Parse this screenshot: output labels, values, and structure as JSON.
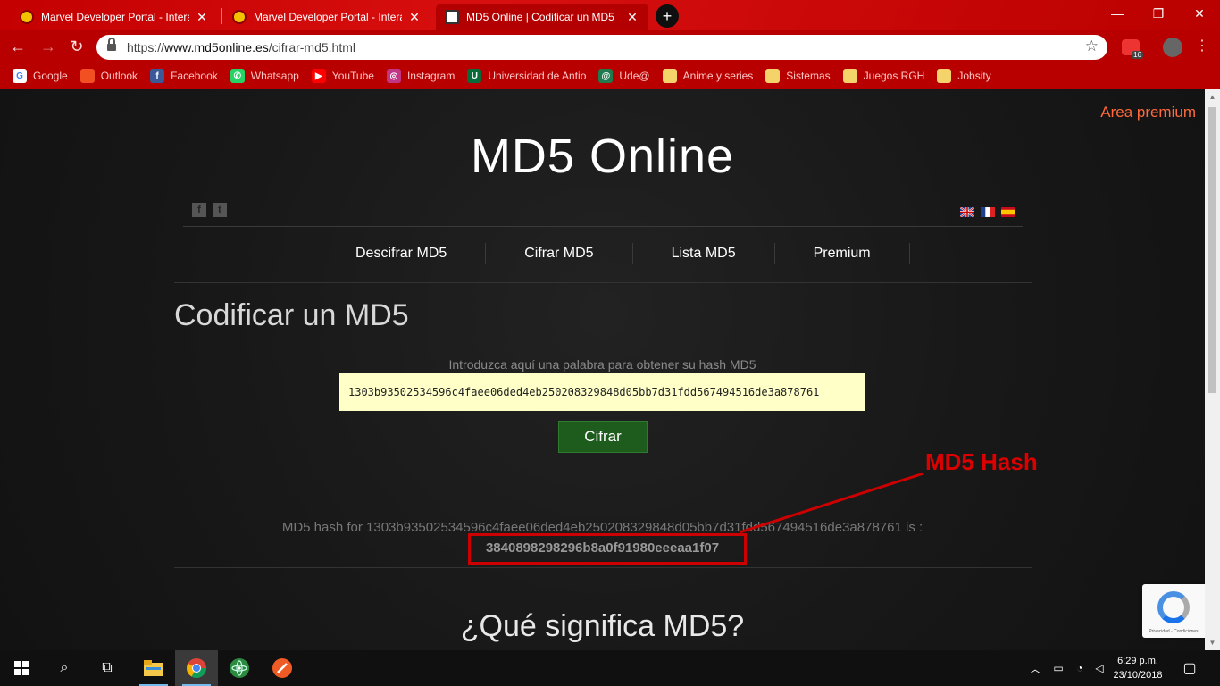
{
  "browser": {
    "tabs": [
      {
        "title": "Marvel Developer Portal - Interac",
        "close": "✕"
      },
      {
        "title": "Marvel Developer Portal - Interac",
        "close": "✕"
      },
      {
        "title": "MD5 Online | Codificar un MD5",
        "close": "✕"
      }
    ],
    "new_tab": "+",
    "window_controls": {
      "minimize": "—",
      "maximize": "❐",
      "close": "✕"
    },
    "url_prefix": "https://",
    "url_host": "www.md5online.es",
    "url_path": "/cifrar-md5.html",
    "extension_badge": "16",
    "bookmarks": [
      {
        "label": "Google",
        "icon": "G",
        "color": "#ffffff"
      },
      {
        "label": "Outlook",
        "icon": "",
        "color": "#f25022"
      },
      {
        "label": "Facebook",
        "icon": "f",
        "color": "#3b5998"
      },
      {
        "label": "Whatsapp",
        "icon": "✆",
        "color": "#25d366"
      },
      {
        "label": "YouTube",
        "icon": "▶",
        "color": "#ff0000"
      },
      {
        "label": "Instagram",
        "icon": "◎",
        "color": "#c13584"
      },
      {
        "label": "Universidad de Antio",
        "icon": "U",
        "color": "#0a6b3a"
      },
      {
        "label": "Ude@",
        "icon": "@",
        "color": "#1f7a4d"
      },
      {
        "label": "Anime y series",
        "icon": "",
        "color": "#f4d36a"
      },
      {
        "label": "Sistemas",
        "icon": "",
        "color": "#f4d36a"
      },
      {
        "label": "Juegos RGH",
        "icon": "",
        "color": "#f4d36a"
      },
      {
        "label": "Jobsity",
        "icon": "",
        "color": "#f4d36a"
      }
    ]
  },
  "page": {
    "premium_link": "Area premium",
    "site_title": "MD5 Online",
    "social": {
      "facebook": "f",
      "twitter": "t"
    },
    "menu": [
      "Descifrar MD5",
      "Cifrar MD5",
      "Lista MD5",
      "Premium"
    ],
    "heading": "Codificar un MD5",
    "input_hint": "Introduzca aquí una palabra para obtener su hash MD5",
    "input_value": "1303b93502534596c4faee06ded4eb250208329848d05bb7d31fdd567494516de3a878761",
    "submit_label": "Cifrar",
    "result_prefix": "MD5 hash for 1303b93502534596c4faee06ded4eb250208329848d05bb7d31fdd567494516de3a878761 is :",
    "result_hash": "3840898298296b8a0f91980eeeaa1f07",
    "annotation_label": "MD5 Hash",
    "section_title": "¿Qué significa MD5?",
    "recaptcha_text": "Privacidad - Condiciones"
  },
  "taskbar": {
    "time": "6:29 p.m.",
    "date": "23/10/2018",
    "apps": [
      "file-explorer",
      "chrome",
      "atom",
      "postman"
    ]
  },
  "colors": {
    "chrome_red": "#b80000",
    "accent_orange": "#ff6a3d",
    "input_bg": "#ffffc8",
    "button_green": "#1e5c1e",
    "annotation_red": "#cc0000"
  }
}
